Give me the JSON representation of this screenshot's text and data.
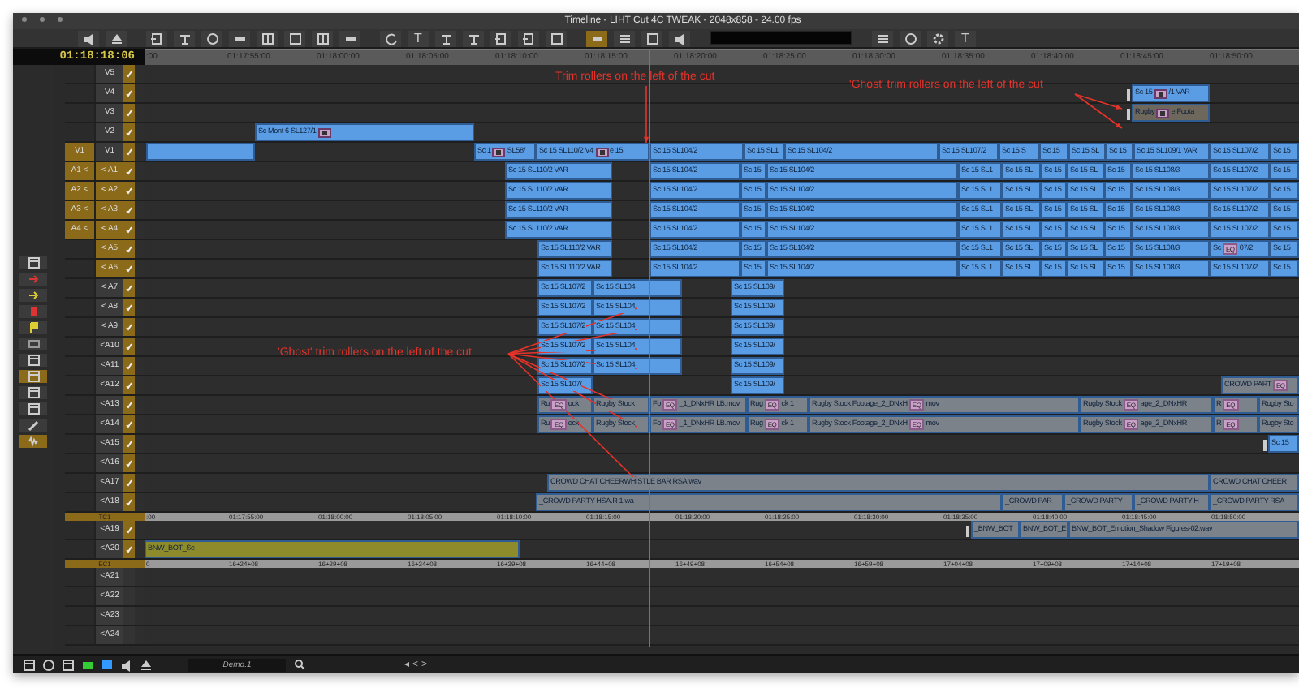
{
  "window": {
    "title": "Timeline - LIHT Cut 4C TWEAK - 2048x858 - 24.00 fps"
  },
  "toolbar": {
    "groups": [
      [
        {
          "kind": "speaker",
          "selected": false
        },
        {
          "kind": "eject",
          "selected": false
        }
      ],
      [
        {
          "kind": "insert",
          "selected": false
        },
        {
          "kind": "lift",
          "selected": false
        },
        {
          "kind": "ring",
          "selected": false
        },
        {
          "kind": "bar",
          "selected": false
        },
        {
          "kind": "grid",
          "selected": false
        },
        {
          "kind": "square",
          "selected": false
        },
        {
          "kind": "grid",
          "selected": false
        },
        {
          "kind": "bar",
          "selected": false
        }
      ],
      [
        {
          "kind": "refresh",
          "selected": false
        },
        {
          "kind": "text",
          "label": "T",
          "selected": false
        },
        {
          "kind": "lift",
          "selected": false
        },
        {
          "kind": "lift",
          "selected": false
        },
        {
          "kind": "insert",
          "selected": false
        },
        {
          "kind": "insert",
          "selected": false
        },
        {
          "kind": "square",
          "selected": false
        }
      ],
      [
        {
          "kind": "bar",
          "selected": true
        },
        {
          "kind": "lines",
          "selected": false
        },
        {
          "kind": "square",
          "selected": false
        },
        {
          "kind": "speaker",
          "selected": false
        }
      ],
      [
        {
          "kind": "lines",
          "selected": false
        },
        {
          "kind": "ring",
          "selected": false
        },
        {
          "kind": "gear",
          "selected": false
        },
        {
          "kind": "text",
          "label": "T",
          "selected": false
        }
      ]
    ]
  },
  "timecode": "01:18:18:06",
  "ruler": [
    ":00",
    "01:17:55:00",
    "01:18:00:00",
    "01:18:05:00",
    "01:18:10:00",
    "01:18:15:00",
    "01:18:20:00",
    "01:18:25:00",
    "01:18:30:00",
    "01:18:35:00",
    "01:18:40:00",
    "01:18:45:00",
    "01:18:50:00"
  ],
  "palette": [
    {
      "kind": "panel",
      "selected": false
    },
    {
      "kind": "red-arrow",
      "selected": false
    },
    {
      "kind": "yellow-arrow",
      "selected": false
    },
    {
      "kind": "red-mark",
      "selected": false
    },
    {
      "kind": "yellow-flag",
      "selected": false
    },
    {
      "kind": "frame",
      "selected": false
    },
    {
      "kind": "panel",
      "selected": false
    },
    {
      "kind": "panel",
      "selected": true
    },
    {
      "kind": "panel",
      "selected": false
    },
    {
      "kind": "panel",
      "selected": false
    },
    {
      "kind": "pencil",
      "selected": false
    },
    {
      "kind": "wave",
      "selected": true
    }
  ],
  "tracks": [
    {
      "kind": "track",
      "label": "V5",
      "monitored": true,
      "selected": false
    },
    {
      "kind": "track",
      "label": "V4",
      "monitored": true,
      "selected": false,
      "clips": [
        {
          "name": "Sc 15",
          "effect": true,
          "tail": "/1 VAR",
          "color": "#5a9de4",
          "roller": true
        }
      ]
    },
    {
      "kind": "track",
      "label": "V3",
      "monitored": true,
      "selected": false,
      "clips": [
        {
          "name": "Rugby",
          "effect": true,
          "tail": "e Foota",
          "color": "#6e675c",
          "roller": true
        }
      ]
    },
    {
      "kind": "track",
      "label": "V2",
      "monitored": true,
      "selected": false,
      "clips": [
        {
          "name": "Sc Mont 6 SL127/1",
          "effect": true,
          "color": "#5a9de4"
        }
      ]
    },
    {
      "kind": "track",
      "label": "V1",
      "source": "V1",
      "monitored": true,
      "selected": false,
      "clips": [
        {
          "color": "#5a9de4"
        },
        {
          "name": "Sc 1",
          "effect": true,
          "tail": "SL58/",
          "color": "#5a9de4"
        },
        {
          "name": "Sc 15 SL110/2 V4",
          "effect": true,
          "tail": "e 15",
          "color": "#5a9de4"
        },
        {
          "name": "Sc 15 SL104/2",
          "color": "#5a9de4"
        },
        {
          "name": "Sc 15 SL1",
          "color": "#5a9de4"
        },
        {
          "name": "Sc 15 SL104/2",
          "color": "#5a9de4"
        },
        {
          "name": "Sc 15 SL107/2",
          "color": "#5a9de4"
        },
        {
          "name": "Sc 15 S",
          "color": "#5a9de4"
        },
        {
          "name": "Sc 15",
          "color": "#5a9de4"
        },
        {
          "name": "Sc 15 SL",
          "color": "#5a9de4"
        },
        {
          "name": "Sc 15",
          "color": "#5a9de4"
        },
        {
          "name": "Sc 15 SL109/1 VAR",
          "color": "#5a9de4"
        },
        {
          "name": "Sc 15 SL107/2",
          "color": "#5a9de4"
        },
        {
          "name": "Sc 15",
          "color": "#5a9de4"
        }
      ]
    },
    {
      "kind": "track",
      "label": "< A1",
      "source": "A1 <",
      "monitored": true,
      "selected": true,
      "clips": [
        {
          "name": "Sc 15 SL110/2 VAR",
          "color": "#5a9de4"
        },
        {
          "name": "Sc 15 SL104/2",
          "color": "#5a9de4"
        },
        {
          "name": "Sc 15",
          "color": "#5a9de4"
        },
        {
          "name": "Sc 15 SL104/2",
          "color": "#5a9de4"
        },
        {
          "name": "Sc 15 SL1",
          "color": "#5a9de4"
        },
        {
          "name": "Sc 15 SL",
          "color": "#5a9de4"
        },
        {
          "name": "Sc 15",
          "color": "#5a9de4"
        },
        {
          "name": "Sc 15 SL",
          "color": "#5a9de4"
        },
        {
          "name": "Sc 15",
          "color": "#5a9de4"
        },
        {
          "name": "Sc 15 SL108/3",
          "color": "#5a9de4"
        },
        {
          "name": "Sc 15 SL107/2",
          "color": "#5a9de4"
        },
        {
          "name": "Sc 15",
          "color": "#5a9de4"
        }
      ]
    },
    {
      "kind": "track",
      "label": "< A2",
      "source": "A2 <",
      "monitored": true,
      "selected": true,
      "clips": [
        {
          "name": "Sc 15 SL110/2 VAR",
          "color": "#5a9de4"
        },
        {
          "name": "Sc 15 SL104/2",
          "color": "#5a9de4"
        },
        {
          "name": "Sc 15",
          "color": "#5a9de4"
        },
        {
          "name": "Sc 15 SL104/2",
          "color": "#5a9de4"
        },
        {
          "name": "Sc 15 SL1",
          "color": "#5a9de4"
        },
        {
          "name": "Sc 15 SL",
          "color": "#5a9de4"
        },
        {
          "name": "Sc 15",
          "color": "#5a9de4"
        },
        {
          "name": "Sc 15 SL",
          "color": "#5a9de4"
        },
        {
          "name": "Sc 15",
          "color": "#5a9de4"
        },
        {
          "name": "Sc 15 SL108/3",
          "color": "#5a9de4"
        },
        {
          "name": "Sc 15 SL107/2",
          "color": "#5a9de4"
        },
        {
          "name": "Sc 15",
          "color": "#5a9de4"
        }
      ]
    },
    {
      "kind": "track",
      "label": "< A3",
      "source": "A3 <",
      "monitored": true,
      "selected": true,
      "clips": [
        {
          "name": "Sc 15 SL110/2 VAR",
          "color": "#5a9de4"
        },
        {
          "name": "Sc 15 SL104/2",
          "color": "#5a9de4"
        },
        {
          "name": "Sc 15",
          "color": "#5a9de4"
        },
        {
          "name": "Sc 15 SL104/2",
          "color": "#5a9de4"
        },
        {
          "name": "Sc 15 SL1",
          "color": "#5a9de4"
        },
        {
          "name": "Sc 15 SL",
          "color": "#5a9de4"
        },
        {
          "name": "Sc 15",
          "color": "#5a9de4"
        },
        {
          "name": "Sc 15 SL",
          "color": "#5a9de4"
        },
        {
          "name": "Sc 15",
          "color": "#5a9de4"
        },
        {
          "name": "Sc 15 SL108/3",
          "color": "#5a9de4"
        },
        {
          "name": "Sc 15 SL107/2",
          "color": "#5a9de4"
        },
        {
          "name": "Sc 15",
          "color": "#5a9de4"
        }
      ]
    },
    {
      "kind": "track",
      "label": "< A4",
      "source": "A4 <",
      "monitored": true,
      "selected": true,
      "clips": [
        {
          "name": "Sc 15 SL110/2 VAR",
          "color": "#5a9de4"
        },
        {
          "name": "Sc 15 SL104/2",
          "color": "#5a9de4"
        },
        {
          "name": "Sc 15",
          "color": "#5a9de4"
        },
        {
          "name": "Sc 15 SL104/2",
          "color": "#5a9de4"
        },
        {
          "name": "Sc 15 SL1",
          "color": "#5a9de4"
        },
        {
          "name": "Sc 15 SL",
          "color": "#5a9de4"
        },
        {
          "name": "Sc 15",
          "color": "#5a9de4"
        },
        {
          "name": "Sc 15 SL",
          "color": "#5a9de4"
        },
        {
          "name": "Sc 15",
          "color": "#5a9de4"
        },
        {
          "name": "Sc 15 SL108/3",
          "color": "#5a9de4"
        },
        {
          "name": "Sc 15 SL107/2",
          "color": "#5a9de4"
        },
        {
          "name": "Sc 15",
          "color": "#5a9de4"
        }
      ]
    },
    {
      "kind": "track",
      "label": "< A5",
      "monitored": true,
      "selected": true,
      "clips": [
        {
          "name": "Sc 15 SL110/2 VAR",
          "color": "#5a9de4"
        },
        {
          "name": "Sc 15 SL104/2",
          "color": "#5a9de4"
        },
        {
          "name": "Sc 15",
          "color": "#5a9de4"
        },
        {
          "name": "Sc 15 SL104/2",
          "color": "#5a9de4"
        },
        {
          "name": "Sc 15 SL1",
          "color": "#5a9de4"
        },
        {
          "name": "Sc 15 SL",
          "color": "#5a9de4"
        },
        {
          "name": "Sc 15",
          "color": "#5a9de4"
        },
        {
          "name": "Sc 15 SL",
          "color": "#5a9de4"
        },
        {
          "name": "Sc 15",
          "color": "#5a9de4"
        },
        {
          "name": "Sc 15 SL108/3",
          "color": "#5a9de4"
        },
        {
          "name": "Sc",
          "badge": "EQ",
          "tail": "07/2",
          "color": "#5a9de4"
        },
        {
          "name": "Sc 15",
          "color": "#5a9de4"
        }
      ]
    },
    {
      "kind": "track",
      "label": "< A6",
      "monitored": true,
      "selected": true,
      "clips": [
        {
          "name": "Sc 15 SL110/2 VAR",
          "color": "#5a9de4"
        },
        {
          "name": "Sc 15 SL104/2",
          "color": "#5a9de4"
        },
        {
          "name": "Sc 15",
          "color": "#5a9de4"
        },
        {
          "name": "Sc 15 SL104/2",
          "color": "#5a9de4"
        },
        {
          "name": "Sc 15 SL1",
          "color": "#5a9de4"
        },
        {
          "name": "Sc 15 SL",
          "color": "#5a9de4"
        },
        {
          "name": "Sc 15",
          "color": "#5a9de4"
        },
        {
          "name": "Sc 15 SL",
          "color": "#5a9de4"
        },
        {
          "name": "Sc 15",
          "color": "#5a9de4"
        },
        {
          "name": "Sc 15 SL108/3",
          "color": "#5a9de4"
        },
        {
          "name": "Sc 15 SL107/2",
          "color": "#5a9de4"
        },
        {
          "name": "Sc 15",
          "color": "#5a9de4"
        }
      ]
    },
    {
      "kind": "track",
      "label": "< A7",
      "monitored": true,
      "selected": false,
      "clips": [
        {
          "name": "Sc 15 SL107/2",
          "color": "#5a9de4"
        },
        {
          "name": "Sc 15 SL104",
          "color": "#5a9de4"
        },
        {
          "name": "Sc 15 SL109/",
          "color": "#5a9de4"
        }
      ]
    },
    {
      "kind": "track",
      "label": "< A8",
      "monitored": true,
      "selected": false,
      "clips": [
        {
          "name": "Sc 15 SL107/2",
          "color": "#5a9de4"
        },
        {
          "name": "Sc 15 SL104",
          "color": "#5a9de4"
        },
        {
          "name": "Sc 15 SL109/",
          "color": "#5a9de4"
        }
      ]
    },
    {
      "kind": "track",
      "label": "< A9",
      "monitored": true,
      "selected": false,
      "clips": [
        {
          "name": "Sc 15 SL107/2",
          "color": "#5a9de4"
        },
        {
          "name": "Sc 15 SL104",
          "color": "#5a9de4"
        },
        {
          "name": "Sc 15 SL109/",
          "color": "#5a9de4"
        }
      ]
    },
    {
      "kind": "track",
      "label": "<A10",
      "monitored": true,
      "selected": false,
      "clips": [
        {
          "name": "Sc 15 SL107/2",
          "color": "#5a9de4"
        },
        {
          "name": "Sc 15 SL104",
          "color": "#5a9de4"
        },
        {
          "name": "Sc 15 SL109/",
          "color": "#5a9de4"
        }
      ]
    },
    {
      "kind": "track",
      "label": "<A11",
      "monitored": true,
      "selected": false,
      "clips": [
        {
          "name": "Sc 15 SL107/2",
          "color": "#5a9de4"
        },
        {
          "name": "Sc 15 SL104",
          "color": "#5a9de4"
        },
        {
          "name": "Sc 15 SL109/",
          "color": "#5a9de4"
        }
      ]
    },
    {
      "kind": "track",
      "label": "<A12",
      "monitored": true,
      "selected": false,
      "clips": [
        {
          "name": "Sc 15 SL107/",
          "color": "#5a9de4"
        },
        {
          "name": "Sc 15 SL109/",
          "color": "#5a9de4"
        },
        {
          "name": "CROWD PART",
          "badge": "EQ",
          "color": "#7b828a"
        }
      ]
    },
    {
      "kind": "track",
      "label": "<A13",
      "monitored": true,
      "selected": false,
      "clips": [
        {
          "name": "Ru",
          "badge": "EQ",
          "tail": "ock",
          "color": "#7b828a"
        },
        {
          "name": "Rugby Stock",
          "color": "#7b828a"
        },
        {
          "name": "Fo",
          "badge": "EQ",
          "tail": "_1_DNxHR LB.mov",
          "color": "#7b828a"
        },
        {
          "name": "Rug",
          "badge": "EQ",
          "tail": "ck 1",
          "color": "#7b828a"
        },
        {
          "name": "Rugby Stock Footage_2_DNxH",
          "badge": "EQ",
          "tail": "mov",
          "color": "#7b828a"
        },
        {
          "name": "Rugby Stock",
          "badge": "EQ",
          "tail": "age_2_DNxHR",
          "color": "#7b828a"
        },
        {
          "name": "R",
          "badge": "EQ",
          "color": "#7b828a"
        },
        {
          "name": "Rugby Sto",
          "color": "#7b828a"
        }
      ]
    },
    {
      "kind": "track",
      "label": "<A14",
      "monitored": true,
      "selected": false,
      "clips": [
        {
          "name": "Ru",
          "badge": "EQ",
          "tail": "ock",
          "color": "#7b828a"
        },
        {
          "name": "Rugby Stock",
          "color": "#7b828a"
        },
        {
          "name": "Fo",
          "badge": "EQ",
          "tail": "_1_DNxHR LB.mov",
          "color": "#7b828a"
        },
        {
          "name": "Rug",
          "badge": "EQ",
          "tail": "ck 1",
          "color": "#7b828a"
        },
        {
          "name": "Rugby Stock Footage_2_DNxH",
          "badge": "EQ",
          "tail": "mov",
          "color": "#7b828a"
        },
        {
          "name": "Rugby Stock",
          "badge": "EQ",
          "tail": "age_2_DNxHR",
          "color": "#7b828a"
        },
        {
          "name": "R",
          "badge": "EQ",
          "color": "#7b828a"
        },
        {
          "name": "Rugby Sto",
          "color": "#7b828a"
        }
      ]
    },
    {
      "kind": "track",
      "label": "<A15",
      "monitored": true,
      "selected": false,
      "clips": [
        {
          "name": "Sc 15",
          "color": "#5a9de4",
          "roller": true
        }
      ]
    },
    {
      "kind": "track",
      "label": "<A16",
      "monitored": true,
      "selected": false
    },
    {
      "kind": "track",
      "label": "<A17",
      "monitored": true,
      "selected": false,
      "clips": [
        {
          "name": "CROWD CHAT CHEERWHISTLE BAR RSA.wav",
          "color": "#7b828a"
        },
        {
          "name": "CROWD CHAT CHEER",
          "color": "#7b828a"
        }
      ]
    },
    {
      "kind": "track",
      "label": "<A18",
      "monitored": true,
      "selected": false,
      "clips": [
        {
          "name": "_CROWD PARTY HSA.R 1.wa",
          "color": "#7b828a"
        },
        {
          "name": "_CROWD PAR",
          "color": "#7b828a"
        },
        {
          "name": "_CROWD PARTY",
          "color": "#7b828a"
        },
        {
          "name": "_CROWD PARTY H",
          "color": "#7b828a"
        },
        {
          "name": "_CROWD PARTY RSA",
          "color": "#7b828a"
        }
      ]
    },
    {
      "kind": "ruler",
      "label": "TC1",
      "ticks": [
        ":00",
        "01:17:55:00",
        "01:18:00:00",
        "01:18:05:00",
        "01:18:10:00",
        "01:18:15:00",
        "01:18:20:00",
        "01:18:25:00",
        "01:18:30:00",
        "01:18:35:00",
        "01:18:40:00",
        "01:18:45:00",
        "01:18:50:00"
      ]
    },
    {
      "kind": "track",
      "label": "<A19",
      "monitored": true,
      "selected": false,
      "clips": [
        {
          "name": "_BNW_BOT",
          "color": "#7b828a",
          "roller": true
        },
        {
          "name": "BNW_BOT_E",
          "color": "#7b828a"
        },
        {
          "name": "BNW_BOT_Emotion_Shadow Figures-02.wav",
          "color": "#7b828a"
        }
      ]
    },
    {
      "kind": "track",
      "label": "<A20",
      "monitored": true,
      "selected": false,
      "clips": [
        {
          "name": "BNW_BOT_Se",
          "color": "#8e8b2c"
        }
      ]
    },
    {
      "kind": "ruler",
      "label": "EC1",
      "ticks": [
        "0",
        "16+24+08",
        "16+29+08",
        "16+34+08",
        "16+39+08",
        "16+44+08",
        "16+49+08",
        "16+54+08",
        "16+59+08",
        "17+04+08",
        "17+09+08",
        "17+14+08",
        "17+19+08"
      ]
    },
    {
      "kind": "track",
      "label": "<A21",
      "monitored": false,
      "selected": false
    },
    {
      "kind": "track",
      "label": "<A22",
      "monitored": false,
      "selected": false
    },
    {
      "kind": "track",
      "label": "<A23",
      "monitored": false,
      "selected": false
    },
    {
      "kind": "track",
      "label": "<A24",
      "monitored": false,
      "selected": false
    }
  ],
  "annotations": [
    {
      "text": "Trim rollers on the left of the cut"
    },
    {
      "text": "'Ghost' trim rollers on the left of the cut"
    },
    {
      "text": "'Ghost' trim rollers on the left of the cut"
    }
  ],
  "bottom_bar": {
    "tools": [
      {
        "kind": "panel"
      },
      {
        "kind": "ring"
      },
      {
        "kind": "panel"
      },
      {
        "kind": "green"
      },
      {
        "kind": "blue"
      },
      {
        "kind": "speaker"
      },
      {
        "kind": "eject"
      }
    ],
    "bin": "Demo.1",
    "nav": [
      "◂",
      "<",
      ">"
    ]
  }
}
